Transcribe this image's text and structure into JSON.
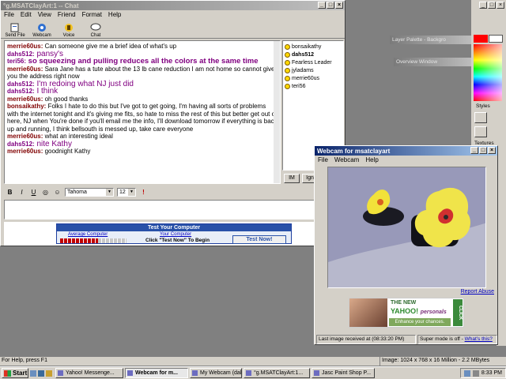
{
  "chat": {
    "title": "°g.MSATClayArt:1 -- Chat",
    "menu": [
      "File",
      "Edit",
      "View",
      "Friend",
      "Format",
      "Help"
    ],
    "toolbar": [
      "Send File",
      "Webcam",
      "Voice",
      "Chat"
    ],
    "messages": [
      {
        "user": "merrie60us:",
        "text": " Can someone give me a brief idea of what's up",
        "style": "m1"
      },
      {
        "user": "dahs512:",
        "text": " pansy's",
        "style": "m2 big"
      },
      {
        "user": "teri56:",
        "text": " so squeezing and pulling reduces all the colors at the same time",
        "style": "m2 bold"
      },
      {
        "user": "merrie60us:",
        "text": " Sara Jane has a tute about the 13 lb cane reduction I am not home so cannot give you the address right now",
        "style": "m1"
      },
      {
        "user": "dahs512:",
        "text": " I'm redoing what NJ just did",
        "style": "m2 big"
      },
      {
        "user": "dahs512:",
        "text": " I think",
        "style": "m2 big"
      },
      {
        "user": "merrie60us:",
        "text": " oh good thanks",
        "style": "m1"
      },
      {
        "user": "bonsaikathy:",
        "text": " Folks I hate to do this but I've got to get going, I'm having all sorts of problems with the internet tonight and it's giving me fits, so hate to miss the rest of this but better get out of here, NJ when You're done if you'll email me the info, I'll download tomorrow if everything is back up and running, I think bellsouth is messed up, take care everyone",
        "style": "m1"
      },
      {
        "user": "merrie60us:",
        "text": " what an interesting ideal",
        "style": "m1"
      },
      {
        "user": "dahs512:",
        "text": " nite Kathy",
        "style": "m2 big"
      },
      {
        "user": "merrie60us:",
        "text": " goodnight Kathy",
        "style": "m1"
      }
    ],
    "users": [
      "bonsaikathy",
      "dahs512",
      "Fearless Leader",
      "jyladams",
      "merrie60us",
      "teri56"
    ],
    "bold_user": "dahs512",
    "im_label": "IM",
    "ignore_label": "Ign",
    "format": {
      "bold": "B",
      "italic": "I",
      "underline": "U",
      "font": "Tahoma",
      "size": "12"
    },
    "ad": {
      "header": "Test Your Computer",
      "average": "Average Computer",
      "yours": "Your Computer",
      "click": "Click \"Test Now\" To Begin",
      "button": "Test Now!"
    }
  },
  "webcam": {
    "title": "Webcam for msatclayart",
    "menu": [
      "File",
      "Webcam",
      "Help"
    ],
    "report": "Report Abuse",
    "ad": {
      "line1": "THE NEW",
      "line2": "YAHOO!",
      "line2b": "personals",
      "line3": "Enhance your chances.",
      "click": "CLICK"
    },
    "status_left": "Last image received at (08:33:20 PM)",
    "status_right": "Super mode is off - ",
    "whats_this": "What's this?"
  },
  "paint": {
    "layer_palette": "Layer Palette - Backgro",
    "overview": "Overview Window",
    "styles": "Styles",
    "textures": "Textures"
  },
  "statusbar": {
    "left": "For Help, press F1",
    "right": "Image:  1024 x 768 x 16 Million - 2.2 MBytes"
  },
  "taskbar": {
    "start": "Start",
    "buttons": [
      {
        "label": "Yahoo! Messenge...",
        "active": false
      },
      {
        "label": "Webcam for m...",
        "active": true
      },
      {
        "label": "My Webcam (dah...",
        "active": false
      },
      {
        "label": "°g.MSATClayArt:1...",
        "active": false
      },
      {
        "label": "Jasc Paint Shop P...",
        "active": false
      }
    ],
    "clock": "8:33 PM"
  },
  "colors": {
    "accent": "#0a246a",
    "chat_user": "#800000",
    "chat_user2": "#800080"
  }
}
